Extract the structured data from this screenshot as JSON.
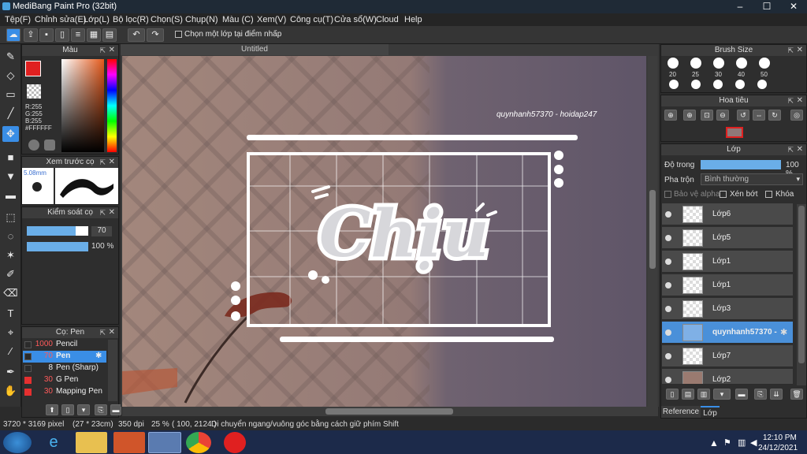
{
  "window": {
    "title": "MediBang Paint Pro (32bit)"
  },
  "menu": [
    "Tệp(F)",
    "Chỉnh sửa(E)",
    "Lớp(L)",
    "Bộ lọc(R)",
    "Chọn(S)",
    "Chụp(N)",
    "Màu (C)",
    "Xem(V)",
    "Công cụ(T)",
    "Cửa sổ(W)",
    "Cloud",
    "Help"
  ],
  "toolbar": {
    "checkbox_label": "Chọn một lớp tại điểm nhấp"
  },
  "canvas": {
    "tab_title": "Untitled",
    "watermark": "quynhanh57370 - hoidap247",
    "artwork_text": "Chịu"
  },
  "color_panel": {
    "title": "Màu",
    "r": "R:255",
    "g": "G:255",
    "b": "B:255",
    "hex": "#FFFFFF"
  },
  "brush_preview": {
    "title": "Xem trước cọ",
    "size": "5.08mm"
  },
  "brush_control": {
    "title": "Kiểm soát cọ",
    "size_value": "70",
    "opacity_value": "100 %"
  },
  "brush_list": {
    "title": "Cọ: Pen",
    "items": [
      {
        "size": "1000",
        "name": "Pencil",
        "color": "#2b2b2b"
      },
      {
        "size": "70",
        "name": "Pen",
        "color": "#2b2b2b"
      },
      {
        "size": "8",
        "name": "Pen (Sharp)",
        "color": "#2b2b2b"
      },
      {
        "size": "30",
        "name": "G Pen",
        "color": "#e53030"
      },
      {
        "size": "30",
        "name": "Mapping Pen",
        "color": "#e53030"
      }
    ]
  },
  "brush_size": {
    "title": "Brush Size",
    "sizes": [
      "20",
      "25",
      "30",
      "40",
      "50"
    ]
  },
  "navigator": {
    "title": "Hoa tiêu"
  },
  "layer_panel": {
    "title": "Lớp",
    "opacity_label": "Độ trong",
    "opacity_value": "100 %",
    "blend_label": "Pha trộn",
    "blend_value": "Bình thường",
    "protect_alpha": "Bảo vệ alpha",
    "clipping": "Xén bớt",
    "lock": "Khóa",
    "layers": [
      "Lớp6",
      "Lớp5",
      "Lớp1",
      "Lớp1",
      "Lớp3",
      "quynhanh57370 -",
      "Lớp7",
      "Lớp2"
    ],
    "tab_reference": "Reference",
    "tab_layer": "Lớp"
  },
  "status": {
    "pixels": "3720 * 3169 pixel",
    "cm": "(27 * 23cm)",
    "dpi": "350 dpi",
    "zoom": "25 %",
    "coords": "( 100, 2124 )",
    "hint": "Di chuyển ngang/vuông góc bằng cách giữ phím Shift"
  },
  "taskbar": {
    "time": "12:10 PM",
    "date": "24/12/2021"
  },
  "colors": {
    "accent": "#3a8ee6",
    "selected_layer": "#4a90d9"
  }
}
